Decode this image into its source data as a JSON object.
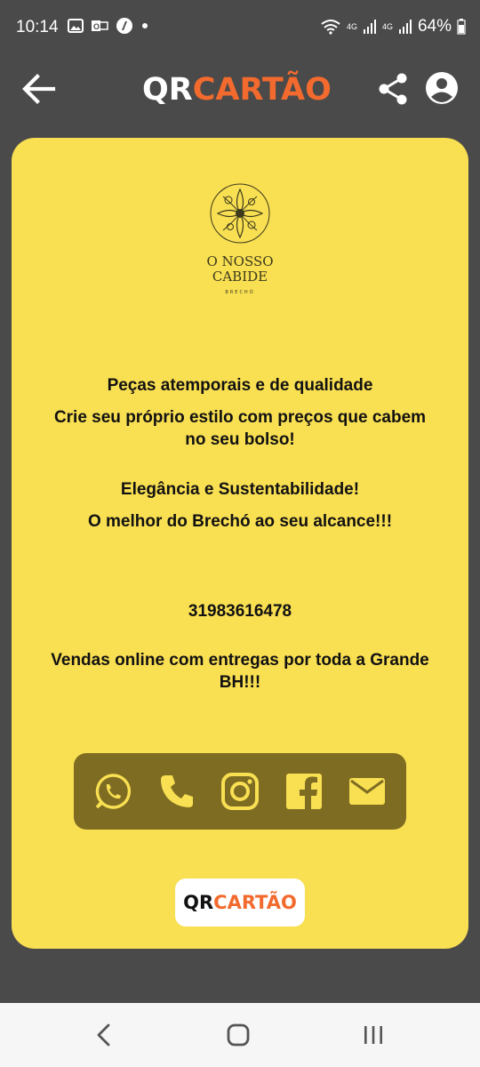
{
  "status_bar": {
    "time": "10:14",
    "battery": "64%",
    "network_1": "4G",
    "network_2": "4G",
    "icons_left": [
      "image-icon",
      "outlook-icon",
      "app-icon",
      "dot-icon"
    ],
    "icons_right": [
      "wifi-icon",
      "signal-icon",
      "signal-icon",
      "battery-icon"
    ]
  },
  "app_bar": {
    "logo_qr": "QR",
    "logo_cartao": "CARTÃO",
    "back_icon": "arrow-left-icon",
    "share_icon": "share-icon",
    "account_icon": "account-circle-icon"
  },
  "card": {
    "brand_name_line1": "O NOSSO",
    "brand_name_line2": "CABIDE",
    "brand_sub": "BRECHÓ",
    "line1": "Peças atemporais e de qualidade",
    "line2": "Crie seu próprio estilo com preços que cabem no seu bolso!",
    "line3": "Elegância e Sustentabilidade!",
    "line4": "O melhor do Brechó ao seu alcance!!!",
    "phone": "31983616478",
    "delivery": "Vendas online com entregas por toda a Grande BH!!!",
    "social": [
      "whatsapp-icon",
      "phone-icon",
      "instagram-icon",
      "facebook-icon",
      "email-icon"
    ],
    "footer_qr": "QR",
    "footer_cartao": "CARTÃO"
  },
  "colors": {
    "background": "#4a4a4a",
    "card": "#f9df52",
    "accent": "#f26a2d",
    "social_bar": "#7d6c22",
    "social_icon": "#f9df52"
  },
  "nav_bar": {
    "buttons": [
      "back-nav-icon",
      "home-nav-icon",
      "recents-nav-icon"
    ]
  }
}
